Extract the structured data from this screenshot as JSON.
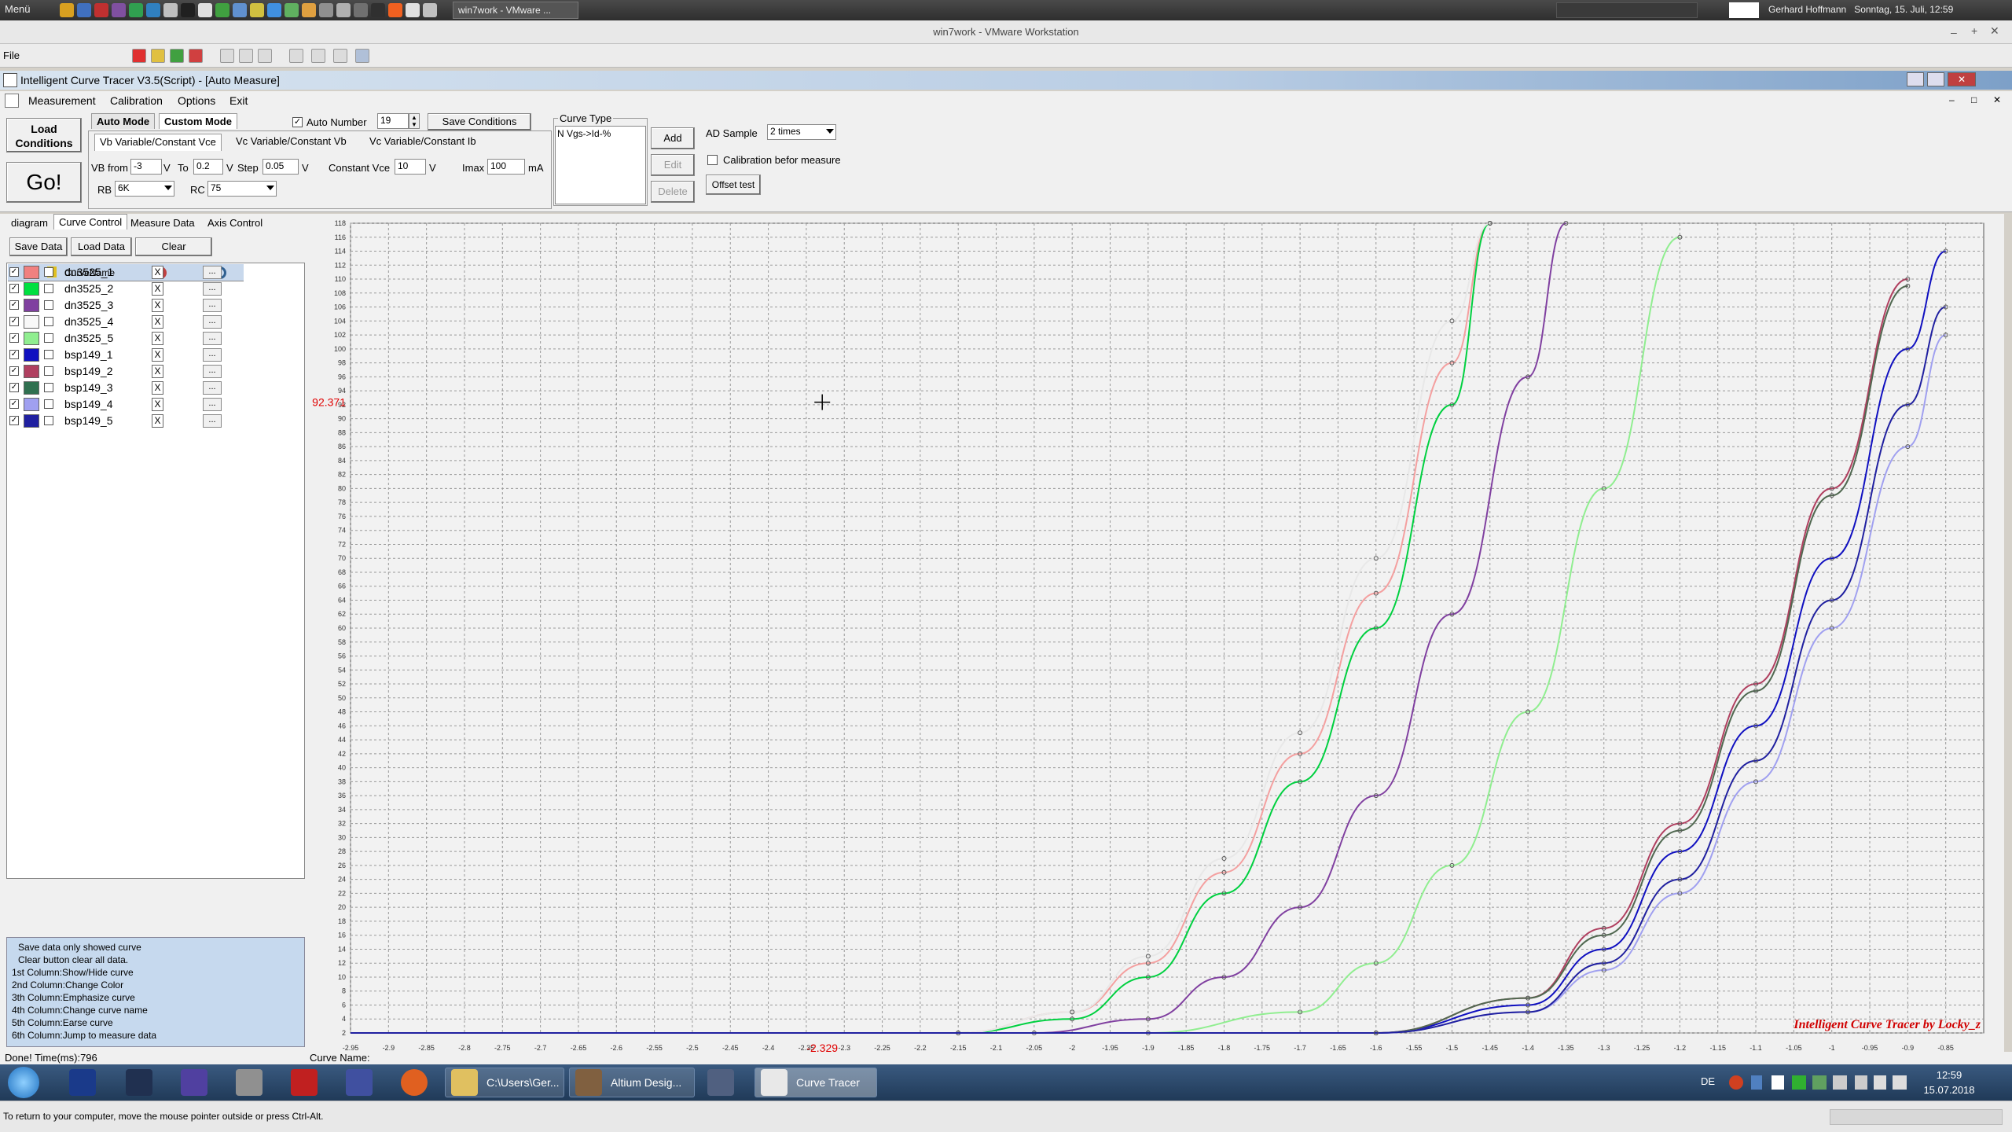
{
  "linux_panel": {
    "menu_label": "Menü",
    "task_label": "win7work - VMware ...",
    "user": "Gerhard Hoffmann",
    "datetime": "Sonntag, 15. Juli, 12:59"
  },
  "vmware": {
    "title": "win7work - VMware Workstation",
    "file_menu": "File",
    "hint": "To return to your computer, move the mouse pointer outside or press Ctrl-Alt."
  },
  "app": {
    "title": "Intelligent Curve Tracer V3.5(Script) - [Auto Measure]",
    "menu": [
      "Measurement",
      "Calibration",
      "Options",
      "Exit"
    ]
  },
  "toolbar": {
    "load_conditions": "Load Conditions",
    "go": "Go!",
    "auto_mode": "Auto Mode",
    "custom_mode": "Custom Mode",
    "auto_number_label": "Auto Number",
    "auto_number_value": "19",
    "save_conditions": "Save Conditions",
    "mode_tabs": [
      "Vb Variable/Constant Vce",
      "Vc Variable/Constant Vb",
      "Vc Variable/Constant Ib"
    ],
    "vb_from_label": "VB from",
    "vb_from_value": "-3",
    "v1": "V",
    "to_label": "To",
    "to_value": "0.2",
    "v2": "V",
    "step_label": "Step",
    "step_value": "0.05",
    "v3": "V",
    "const_vce_label": "Constant Vce",
    "const_vce_value": "10",
    "v4": "V",
    "imax_label": "Imax",
    "imax_value": "100",
    "ma": "mA",
    "rb_label": "RB",
    "rb_value": "6K",
    "rc_label": "RC",
    "rc_value": "75",
    "curve_type_label": "Curve Type",
    "curve_type_value": "N Vgs->Id-%",
    "add": "Add",
    "edit": "Edit",
    "delete": "Delete",
    "ad_sample_label": "AD Sample",
    "ad_sample_value": "2 times",
    "calibration_label": "Calibration befor measure",
    "offset_test": "Offset test"
  },
  "left_tabs": [
    "diagram",
    "Curve Control",
    "Measure Data",
    "Axis Control"
  ],
  "left_buttons": {
    "save": "Save Data",
    "load": "Load Data",
    "clear": "Clear"
  },
  "table_header": {
    "name": "CurveName"
  },
  "curves": [
    {
      "name": "dn3525_1",
      "color": "#f08080",
      "x": "X",
      "more": "..."
    },
    {
      "name": "dn3525_2",
      "color": "#00e040",
      "x": "X",
      "more": "..."
    },
    {
      "name": "dn3525_3",
      "color": "#8040a0",
      "x": "X",
      "more": "..."
    },
    {
      "name": "dn3525_4",
      "color": "#f8f8f8",
      "x": "X",
      "more": "..."
    },
    {
      "name": "dn3525_5",
      "color": "#90ee90",
      "x": "X",
      "more": "..."
    },
    {
      "name": "bsp149_1",
      "color": "#1010c0",
      "x": "X",
      "more": "..."
    },
    {
      "name": "bsp149_2",
      "color": "#b04060",
      "x": "X",
      "more": "..."
    },
    {
      "name": "bsp149_3",
      "color": "#307050",
      "x": "X",
      "more": "..."
    },
    {
      "name": "bsp149_4",
      "color": "#a0a0f0",
      "x": "X",
      "more": "..."
    },
    {
      "name": "bsp149_5",
      "color": "#2020a0",
      "x": "X",
      "more": "..."
    }
  ],
  "help_lines": [
    "Save data only showed curve",
    "Clear button clear all data.",
    "1st Column:Show/Hide curve",
    "2nd Column:Change Color",
    "3th Column:Emphasize curve",
    "4th Column:Change curve name",
    "5th Column:Earse curve",
    "6th Column:Jump to measure data"
  ],
  "status": {
    "done": "Done!  Time(ms):796",
    "curve_name": "Curve Name:"
  },
  "chart_data": {
    "type": "line",
    "cursor_y_label": "92.371",
    "cursor_x_label": "-2.329",
    "watermark": "Intelligent Curve Tracer by Locky_z",
    "xlim": [
      -2.95,
      -0.8
    ],
    "ylim": [
      2,
      118
    ],
    "x_ticks": [
      "-2.95",
      "-2.9",
      "-2.85",
      "-2.8",
      "-2.75",
      "-2.7",
      "-2.65",
      "-2.6",
      "-2.55",
      "-2.5",
      "-2.45",
      "-2.4",
      "-2.35",
      "-2.3",
      "-2.25",
      "-2.2",
      "-2.15",
      "-2.1",
      "-2.05",
      "-2",
      "-1.95",
      "-1.9",
      "-1.85",
      "-1.8",
      "-1.75",
      "-1.7",
      "-1.65",
      "-1.6",
      "-1.55",
      "-1.5",
      "-1.45",
      "-1.4",
      "-1.35",
      "-1.3",
      "-1.25",
      "-1.2",
      "-1.15",
      "-1.1",
      "-1.05",
      "-1",
      "-0.95",
      "-0.9",
      "-0.85"
    ],
    "y_ticks": [
      2,
      4,
      6,
      8,
      10,
      12,
      14,
      16,
      18,
      20,
      22,
      24,
      26,
      28,
      30,
      32,
      34,
      36,
      38,
      40,
      42,
      44,
      46,
      48,
      50,
      52,
      54,
      56,
      58,
      60,
      62,
      64,
      66,
      68,
      70,
      72,
      74,
      76,
      78,
      80,
      82,
      84,
      86,
      88,
      90,
      92,
      94,
      96,
      98,
      100,
      102,
      104,
      106,
      108,
      110,
      112,
      114,
      116,
      118
    ],
    "series": [
      {
        "name": "dn3525_1",
        "color": "#f4a0a0",
        "x": [
          -2.15,
          -2.0,
          -1.9,
          -1.8,
          -1.7,
          -1.6,
          -1.5,
          -1.45
        ],
        "y": [
          2,
          5,
          12,
          25,
          42,
          65,
          98,
          118
        ]
      },
      {
        "name": "dn3525_2",
        "color": "#00d040",
        "x": [
          -2.15,
          -2.0,
          -1.9,
          -1.8,
          -1.7,
          -1.6,
          -1.5,
          -1.45
        ],
        "y": [
          2,
          4,
          10,
          22,
          38,
          60,
          92,
          118
        ]
      },
      {
        "name": "dn3525_3",
        "color": "#8040a0",
        "x": [
          -2.05,
          -1.9,
          -1.8,
          -1.7,
          -1.6,
          -1.5,
          -1.4,
          -1.35
        ],
        "y": [
          2,
          4,
          10,
          20,
          36,
          62,
          96,
          118
        ]
      },
      {
        "name": "dn3525_4",
        "color": "#e8e8e8",
        "x": [
          -2.15,
          -2.0,
          -1.9,
          -1.8,
          -1.7,
          -1.6,
          -1.5,
          -1.45
        ],
        "y": [
          2,
          5,
          13,
          27,
          45,
          70,
          104,
          118
        ]
      },
      {
        "name": "dn3525_5",
        "color": "#90ee90",
        "x": [
          -1.9,
          -1.7,
          -1.6,
          -1.5,
          -1.4,
          -1.3,
          -1.2
        ],
        "y": [
          2,
          5,
          12,
          26,
          48,
          80,
          116
        ]
      },
      {
        "name": "bsp149_1",
        "color": "#1010c0",
        "x": [
          -1.6,
          -1.4,
          -1.3,
          -1.2,
          -1.1,
          -1.0,
          -0.9,
          -0.85
        ],
        "y": [
          2,
          6,
          14,
          28,
          46,
          70,
          100,
          114
        ]
      },
      {
        "name": "bsp149_2",
        "color": "#b04060",
        "x": [
          -1.6,
          -1.4,
          -1.3,
          -1.2,
          -1.1,
          -1.0,
          -0.9
        ],
        "y": [
          2,
          7,
          17,
          32,
          52,
          80,
          110
        ]
      },
      {
        "name": "bsp149_3",
        "color": "#506850",
        "x": [
          -1.6,
          -1.4,
          -1.3,
          -1.2,
          -1.1,
          -1.0,
          -0.9
        ],
        "y": [
          2,
          7,
          16,
          31,
          51,
          79,
          109
        ]
      },
      {
        "name": "bsp149_4",
        "color": "#a0a0f0",
        "x": [
          -1.6,
          -1.4,
          -1.3,
          -1.2,
          -1.1,
          -1.0,
          -0.9,
          -0.85
        ],
        "y": [
          2,
          5,
          11,
          22,
          38,
          60,
          86,
          102
        ]
      },
      {
        "name": "bsp149_5",
        "color": "#2020a0",
        "x": [
          -1.6,
          -1.4,
          -1.3,
          -1.2,
          -1.1,
          -1.0,
          -0.9,
          -0.85
        ],
        "y": [
          2,
          5,
          12,
          24,
          41,
          64,
          92,
          106
        ]
      }
    ]
  },
  "win_taskbar": {
    "tasks": [
      "C:\\Users\\Ger...",
      "Altium Desig...",
      "Curve Tracer"
    ],
    "lang": "DE",
    "time": "12:59",
    "date": "15.07.2018"
  }
}
